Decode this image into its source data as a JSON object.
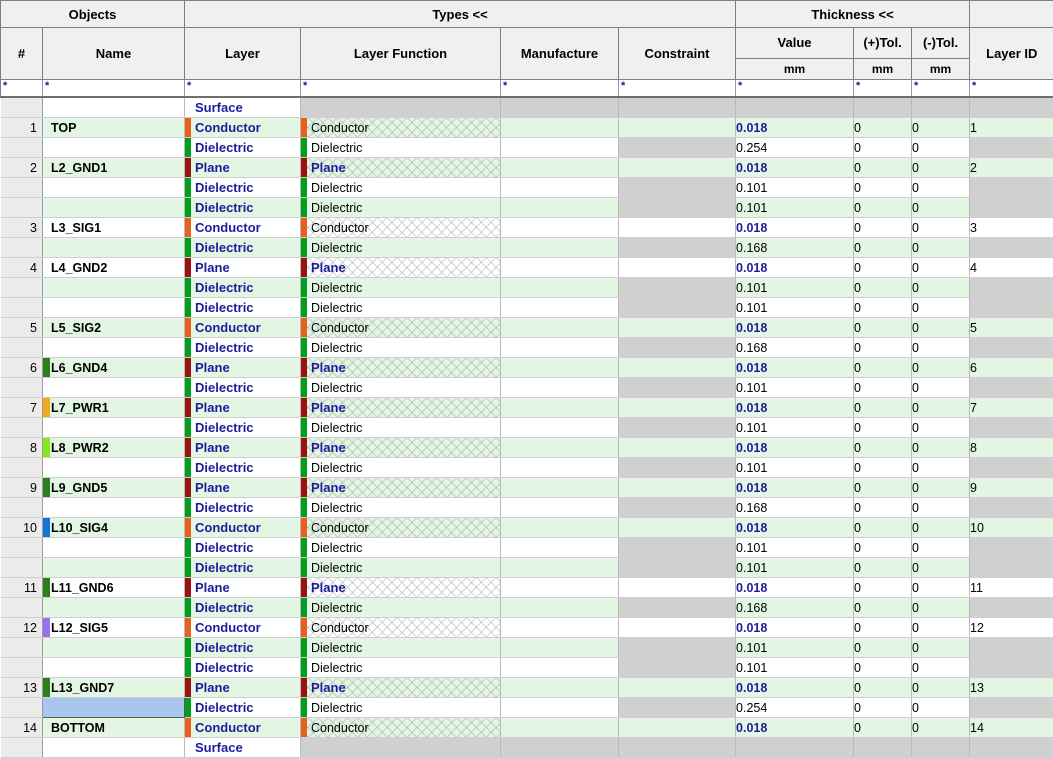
{
  "header": {
    "groups": [
      {
        "label": "Objects",
        "span": 2
      },
      {
        "label": "Types <<",
        "span": 4
      },
      {
        "label": "Thickness <<",
        "span": 3
      },
      {
        "label": "",
        "span": 1
      }
    ],
    "columns": [
      {
        "label": "#",
        "sub": ""
      },
      {
        "label": "Name",
        "sub": ""
      },
      {
        "label": "Layer",
        "sub": ""
      },
      {
        "label": "Layer Function",
        "sub": ""
      },
      {
        "label": "Manufacture",
        "sub": ""
      },
      {
        "label": "Constraint",
        "sub": ""
      },
      {
        "label": "Value",
        "sub": "mm"
      },
      {
        "label": "(+)Tol.",
        "sub": "mm"
      },
      {
        "label": "(-)Tol.",
        "sub": "mm"
      },
      {
        "label": "Layer ID",
        "sub": ""
      }
    ],
    "filter_marker": "*"
  },
  "colors": {
    "conductor_bar": "#e8601c",
    "dielectric_bar": "#00a01e",
    "plane_bar": "#9c1111",
    "row_green": "#e3f5e3",
    "row_white": "#ffffff",
    "row_gray": "#d0d0d0",
    "selection": "#a8c6ee",
    "text_blue": "#1c1c9c",
    "header_bg": "#f0f0f0"
  },
  "rows": [
    {
      "num": "",
      "name": "",
      "swatch": "",
      "layer": "Surface",
      "func": "",
      "manufacture": "",
      "constraint": "",
      "value": "",
      "plus_tol": "",
      "minus_tol": "",
      "layer_id": "",
      "shade": "white",
      "kind": "surface"
    },
    {
      "num": "1",
      "name": "TOP",
      "swatch": "",
      "layer": "Conductor",
      "func": "Conductor",
      "manufacture": "",
      "constraint": "",
      "value": "0.018",
      "plus_tol": "0",
      "minus_tol": "0",
      "layer_id": "1",
      "shade": "green",
      "kind": "conductor"
    },
    {
      "num": "",
      "name": "",
      "swatch": "",
      "layer": "Dielectric",
      "func": "Dielectric",
      "manufacture": "",
      "constraint": "",
      "value": "0.254",
      "plus_tol": "0",
      "minus_tol": "0",
      "layer_id": "",
      "shade": "white",
      "kind": "dielectric"
    },
    {
      "num": "2",
      "name": "L2_GND1",
      "swatch": "",
      "layer": "Plane",
      "func": "Plane",
      "manufacture": "",
      "constraint": "",
      "value": "0.018",
      "plus_tol": "0",
      "minus_tol": "0",
      "layer_id": "2",
      "shade": "green",
      "kind": "plane"
    },
    {
      "num": "",
      "name": "",
      "swatch": "",
      "layer": "Dielectric",
      "func": "Dielectric",
      "manufacture": "",
      "constraint": "",
      "value": "0.101",
      "plus_tol": "0",
      "minus_tol": "0",
      "layer_id": "",
      "shade": "white",
      "kind": "dielectric"
    },
    {
      "num": "",
      "name": "",
      "swatch": "",
      "layer": "Dielectric",
      "func": "Dielectric",
      "manufacture": "",
      "constraint": "",
      "value": "0.101",
      "plus_tol": "0",
      "minus_tol": "0",
      "layer_id": "",
      "shade": "green",
      "kind": "dielectric"
    },
    {
      "num": "3",
      "name": "L3_SIG1",
      "swatch": "",
      "layer": "Conductor",
      "func": "Conductor",
      "manufacture": "",
      "constraint": "",
      "value": "0.018",
      "plus_tol": "0",
      "minus_tol": "0",
      "layer_id": "3",
      "shade": "white",
      "kind": "conductor"
    },
    {
      "num": "",
      "name": "",
      "swatch": "",
      "layer": "Dielectric",
      "func": "Dielectric",
      "manufacture": "",
      "constraint": "",
      "value": "0.168",
      "plus_tol": "0",
      "minus_tol": "0",
      "layer_id": "",
      "shade": "green",
      "kind": "dielectric"
    },
    {
      "num": "4",
      "name": "L4_GND2",
      "swatch": "",
      "layer": "Plane",
      "func": "Plane",
      "manufacture": "",
      "constraint": "",
      "value": "0.018",
      "plus_tol": "0",
      "minus_tol": "0",
      "layer_id": "4",
      "shade": "white",
      "kind": "plane"
    },
    {
      "num": "",
      "name": "",
      "swatch": "",
      "layer": "Dielectric",
      "func": "Dielectric",
      "manufacture": "",
      "constraint": "",
      "value": "0.101",
      "plus_tol": "0",
      "minus_tol": "0",
      "layer_id": "",
      "shade": "green",
      "kind": "dielectric"
    },
    {
      "num": "",
      "name": "",
      "swatch": "",
      "layer": "Dielectric",
      "func": "Dielectric",
      "manufacture": "",
      "constraint": "",
      "value": "0.101",
      "plus_tol": "0",
      "minus_tol": "0",
      "layer_id": "",
      "shade": "white",
      "kind": "dielectric"
    },
    {
      "num": "5",
      "name": "L5_SIG2",
      "swatch": "",
      "layer": "Conductor",
      "func": "Conductor",
      "manufacture": "",
      "constraint": "",
      "value": "0.018",
      "plus_tol": "0",
      "minus_tol": "0",
      "layer_id": "5",
      "shade": "green",
      "kind": "conductor"
    },
    {
      "num": "",
      "name": "",
      "swatch": "",
      "layer": "Dielectric",
      "func": "Dielectric",
      "manufacture": "",
      "constraint": "",
      "value": "0.168",
      "plus_tol": "0",
      "minus_tol": "0",
      "layer_id": "",
      "shade": "white",
      "kind": "dielectric"
    },
    {
      "num": "6",
      "name": "L6_GND4",
      "swatch": "#2e7d1e",
      "layer": "Plane",
      "func": "Plane",
      "manufacture": "",
      "constraint": "",
      "value": "0.018",
      "plus_tol": "0",
      "minus_tol": "0",
      "layer_id": "6",
      "shade": "green",
      "kind": "plane"
    },
    {
      "num": "",
      "name": "",
      "swatch": "",
      "layer": "Dielectric",
      "func": "Dielectric",
      "manufacture": "",
      "constraint": "",
      "value": "0.101",
      "plus_tol": "0",
      "minus_tol": "0",
      "layer_id": "",
      "shade": "white",
      "kind": "dielectric"
    },
    {
      "num": "7",
      "name": "L7_PWR1",
      "swatch": "#f0a81e",
      "layer": "Plane",
      "func": "Plane",
      "manufacture": "",
      "constraint": "",
      "value": "0.018",
      "plus_tol": "0",
      "minus_tol": "0",
      "layer_id": "7",
      "shade": "green",
      "kind": "plane"
    },
    {
      "num": "",
      "name": "",
      "swatch": "",
      "layer": "Dielectric",
      "func": "Dielectric",
      "manufacture": "",
      "constraint": "",
      "value": "0.101",
      "plus_tol": "0",
      "minus_tol": "0",
      "layer_id": "",
      "shade": "white",
      "kind": "dielectric"
    },
    {
      "num": "8",
      "name": "L8_PWR2",
      "swatch": "#86e81e",
      "layer": "Plane",
      "func": "Plane",
      "manufacture": "",
      "constraint": "",
      "value": "0.018",
      "plus_tol": "0",
      "minus_tol": "0",
      "layer_id": "8",
      "shade": "green",
      "kind": "plane"
    },
    {
      "num": "",
      "name": "",
      "swatch": "",
      "layer": "Dielectric",
      "func": "Dielectric",
      "manufacture": "",
      "constraint": "",
      "value": "0.101",
      "plus_tol": "0",
      "minus_tol": "0",
      "layer_id": "",
      "shade": "white",
      "kind": "dielectric"
    },
    {
      "num": "9",
      "name": "L9_GND5",
      "swatch": "#2e7d1e",
      "layer": "Plane",
      "func": "Plane",
      "manufacture": "",
      "constraint": "",
      "value": "0.018",
      "plus_tol": "0",
      "minus_tol": "0",
      "layer_id": "9",
      "shade": "green",
      "kind": "plane"
    },
    {
      "num": "",
      "name": "",
      "swatch": "",
      "layer": "Dielectric",
      "func": "Dielectric",
      "manufacture": "",
      "constraint": "",
      "value": "0.168",
      "plus_tol": "0",
      "minus_tol": "0",
      "layer_id": "",
      "shade": "white",
      "kind": "dielectric"
    },
    {
      "num": "10",
      "name": "L10_SIG4",
      "swatch": "#1572d6",
      "layer": "Conductor",
      "func": "Conductor",
      "manufacture": "",
      "constraint": "",
      "value": "0.018",
      "plus_tol": "0",
      "minus_tol": "0",
      "layer_id": "10",
      "shade": "green",
      "kind": "conductor"
    },
    {
      "num": "",
      "name": "",
      "swatch": "",
      "layer": "Dielectric",
      "func": "Dielectric",
      "manufacture": "",
      "constraint": "",
      "value": "0.101",
      "plus_tol": "0",
      "minus_tol": "0",
      "layer_id": "",
      "shade": "white",
      "kind": "dielectric"
    },
    {
      "num": "",
      "name": "",
      "swatch": "",
      "layer": "Dielectric",
      "func": "Dielectric",
      "manufacture": "",
      "constraint": "",
      "value": "0.101",
      "plus_tol": "0",
      "minus_tol": "0",
      "layer_id": "",
      "shade": "green",
      "kind": "dielectric"
    },
    {
      "num": "11",
      "name": "L11_GND6",
      "swatch": "#2e7d1e",
      "layer": "Plane",
      "func": "Plane",
      "manufacture": "",
      "constraint": "",
      "value": "0.018",
      "plus_tol": "0",
      "minus_tol": "0",
      "layer_id": "11",
      "shade": "white",
      "kind": "plane"
    },
    {
      "num": "",
      "name": "",
      "swatch": "",
      "layer": "Dielectric",
      "func": "Dielectric",
      "manufacture": "",
      "constraint": "",
      "value": "0.168",
      "plus_tol": "0",
      "minus_tol": "0",
      "layer_id": "",
      "shade": "green",
      "kind": "dielectric"
    },
    {
      "num": "12",
      "name": "L12_SIG5",
      "swatch": "#9b6ef0",
      "layer": "Conductor",
      "func": "Conductor",
      "manufacture": "",
      "constraint": "",
      "value": "0.018",
      "plus_tol": "0",
      "minus_tol": "0",
      "layer_id": "12",
      "shade": "white",
      "kind": "conductor"
    },
    {
      "num": "",
      "name": "",
      "swatch": "",
      "layer": "Dielectric",
      "func": "Dielectric",
      "manufacture": "",
      "constraint": "",
      "value": "0.101",
      "plus_tol": "0",
      "minus_tol": "0",
      "layer_id": "",
      "shade": "green",
      "kind": "dielectric"
    },
    {
      "num": "",
      "name": "",
      "swatch": "",
      "layer": "Dielectric",
      "func": "Dielectric",
      "manufacture": "",
      "constraint": "",
      "value": "0.101",
      "plus_tol": "0",
      "minus_tol": "0",
      "layer_id": "",
      "shade": "white",
      "kind": "dielectric"
    },
    {
      "num": "13",
      "name": "L13_GND7",
      "swatch": "#2e7d1e",
      "layer": "Plane",
      "func": "Plane",
      "manufacture": "",
      "constraint": "",
      "value": "0.018",
      "plus_tol": "0",
      "minus_tol": "0",
      "layer_id": "13",
      "shade": "green",
      "kind": "plane"
    },
    {
      "num": "",
      "name": "",
      "swatch": "",
      "layer": "Dielectric",
      "func": "Dielectric",
      "manufacture": "",
      "constraint": "",
      "value": "0.254",
      "plus_tol": "0",
      "minus_tol": "0",
      "layer_id": "",
      "shade": "white",
      "kind": "dielectric",
      "name_selected": true
    },
    {
      "num": "14",
      "name": "BOTTOM",
      "swatch": "",
      "layer": "Conductor",
      "func": "Conductor",
      "manufacture": "",
      "constraint": "",
      "value": "0.018",
      "plus_tol": "0",
      "minus_tol": "0",
      "layer_id": "14",
      "shade": "green",
      "kind": "conductor"
    },
    {
      "num": "",
      "name": "",
      "swatch": "",
      "layer": "Surface",
      "func": "",
      "manufacture": "",
      "constraint": "",
      "value": "",
      "plus_tol": "",
      "minus_tol": "",
      "layer_id": "",
      "shade": "white",
      "kind": "surface"
    }
  ]
}
